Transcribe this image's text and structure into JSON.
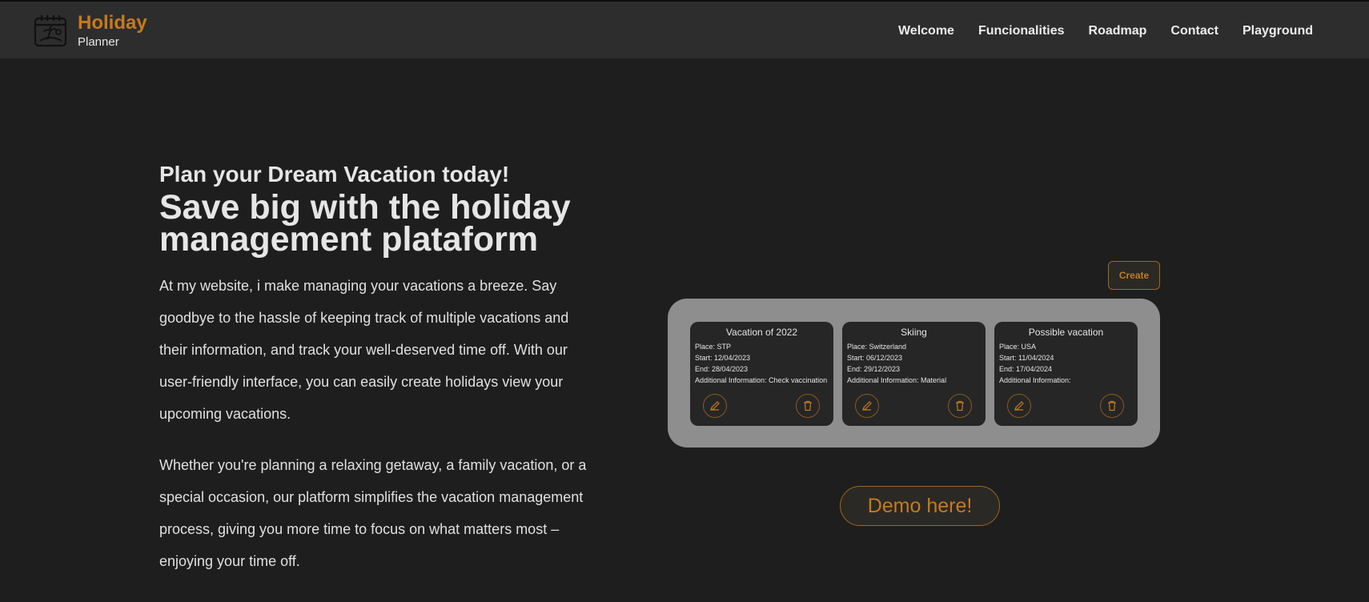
{
  "header": {
    "logo_title": "Holiday",
    "logo_subtitle": "Planner",
    "nav": [
      "Welcome",
      "Funcionalities",
      "Roadmap",
      "Contact",
      "Playground"
    ]
  },
  "hero": {
    "subtitle": "Plan your Dream Vacation today!",
    "title": "Save big with the holiday management plataform",
    "paragraph_1": "At my website, i make managing your vacations a breeze. Say goodbye to the hassle of keeping track of multiple vacations and their information, and track your well-deserved time off. With our user-friendly interface, you can easily create holidays view your upcoming vacations.",
    "paragraph_2": "Whether you're planning a relaxing getaway, a family vacation, or a special occasion, our platform simplifies the vacation management process, giving you more time to focus on what matters most – enjoying your time off."
  },
  "demo": {
    "create_label": "Create",
    "demo_label": "Demo here!",
    "cards": [
      {
        "title": "Vacation of 2022",
        "place": "Place: STP",
        "start": "Start: 12/04/2023",
        "end": "End: 28/04/2023",
        "info": "Additional Information: Check vaccination"
      },
      {
        "title": "Skiing",
        "place": "Place: Switzerland",
        "start": "Start: 06/12/2023",
        "end": "End: 29/12/2023",
        "info": "Additional Information: Material"
      },
      {
        "title": "Possible vacation",
        "place": "Place: USA",
        "start": "Start: 11/04/2024",
        "end": "End: 17/04/2024",
        "info": "Additional Information:"
      }
    ]
  },
  "colors": {
    "background": "#1e1e1f",
    "header": "#2d2d2e",
    "accent": "#c77a1c",
    "panel": "#8e8e8e",
    "card": "#262627"
  },
  "icons": {
    "logo": "calendar-beach-icon",
    "edit": "pencil-icon",
    "delete": "trash-icon"
  }
}
